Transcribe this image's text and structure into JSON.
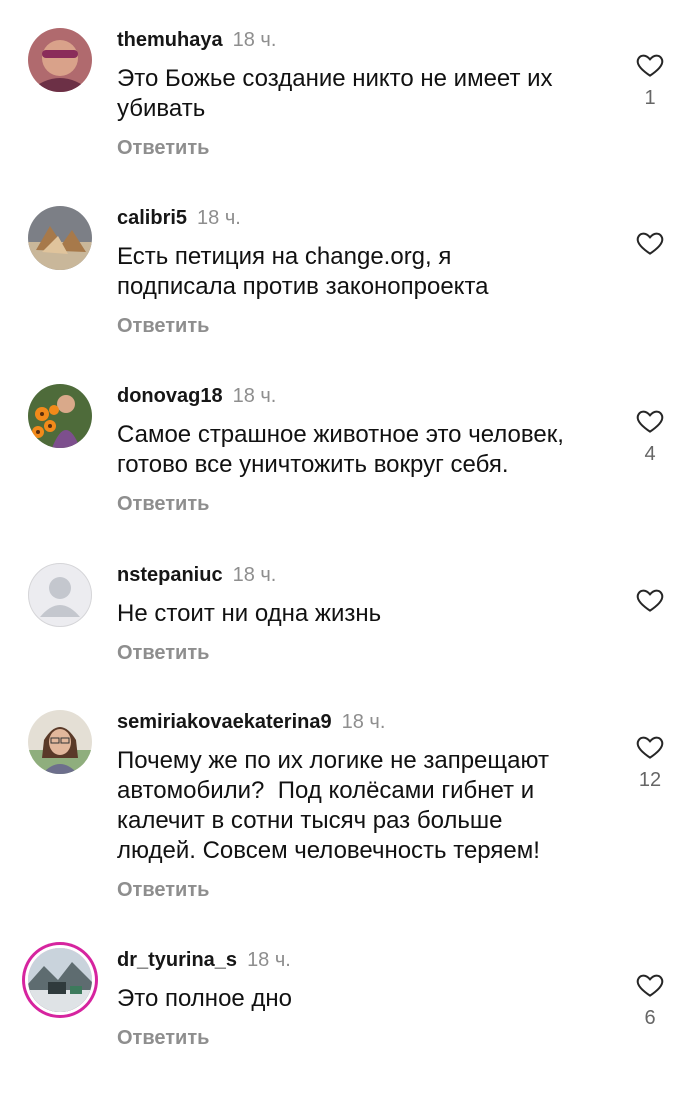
{
  "comments": [
    {
      "username": "themuhaya",
      "time": "18 ч.",
      "text": "Это Божье создание никто не имеет их\nубивать",
      "reply": "Ответить",
      "likes": "1"
    },
    {
      "username": "calibri5",
      "time": "18 ч.",
      "text": "Есть петиция на change.org, я\nподписала против законопроекта",
      "reply": "Ответить",
      "likes": ""
    },
    {
      "username": "donovag18",
      "time": "18 ч.",
      "text": "Самое страшное животное это человек,\nготово все уничтожить вокруг себя.",
      "reply": "Ответить",
      "likes": "4"
    },
    {
      "username": "nstepaniuc",
      "time": "18 ч.",
      "text": "Не стоит ни одна жизнь",
      "reply": "Ответить",
      "likes": ""
    },
    {
      "username": "semiriakovaekaterina9",
      "time": "18 ч.",
      "text": "Почему же по их логике не запрещают\nавтомобили?  Под колёсами гибнет и\nкалечит в сотни тысяч раз больше\nлюдей. Совсем человечность теряем!",
      "reply": "Ответить",
      "likes": "12"
    },
    {
      "username": "dr_tyurina_s",
      "time": "18 ч.",
      "text": "Это полное дно",
      "reply": "Ответить",
      "likes": "6"
    }
  ]
}
